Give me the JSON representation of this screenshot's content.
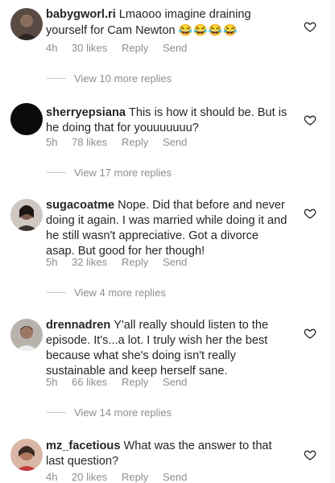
{
  "comments": [
    {
      "username": "babygworl.ri",
      "text": "Lmaooo imagine draining yourself for Cam Newton",
      "emoji": "😂😂😂😂",
      "time": "4h",
      "likes": "30 likes",
      "reply": "Reply",
      "send": "Send",
      "more_replies": "View 10 more replies"
    },
    {
      "username": "sherryepsiana",
      "text": "This is how it should be. But is he doing that for youuuuuuu?",
      "time": "5h",
      "likes": "78 likes",
      "reply": "Reply",
      "send": "Send",
      "more_replies": "View 17 more replies"
    },
    {
      "username": "sugacoatme",
      "text": "Nope. Did that before and never doing it again. I was married while doing it and he still wasn't appreciative. Got a divorce asap. But good for her though!",
      "time": "5h",
      "likes": "32 likes",
      "reply": "Reply",
      "send": "Send",
      "more_replies": "View 4 more replies"
    },
    {
      "username": "drennadren",
      "text": "Y'all really should listen to the episode. It's...a lot. I truly wish her the best because what she's doing isn't really sustainable and keep herself sane.",
      "time": "5h",
      "likes": "66 likes",
      "reply": "Reply",
      "send": "Send",
      "more_replies": "View 14 more replies"
    },
    {
      "username": "mz_facetious",
      "text": "What was the answer to that last question?",
      "time": "4h",
      "likes": "20 likes",
      "reply": "Reply",
      "send": "Send"
    }
  ],
  "icons": {
    "like": "heart-outline-icon"
  },
  "colors": {
    "text": "#262626",
    "muted": "#8e8e8e"
  }
}
